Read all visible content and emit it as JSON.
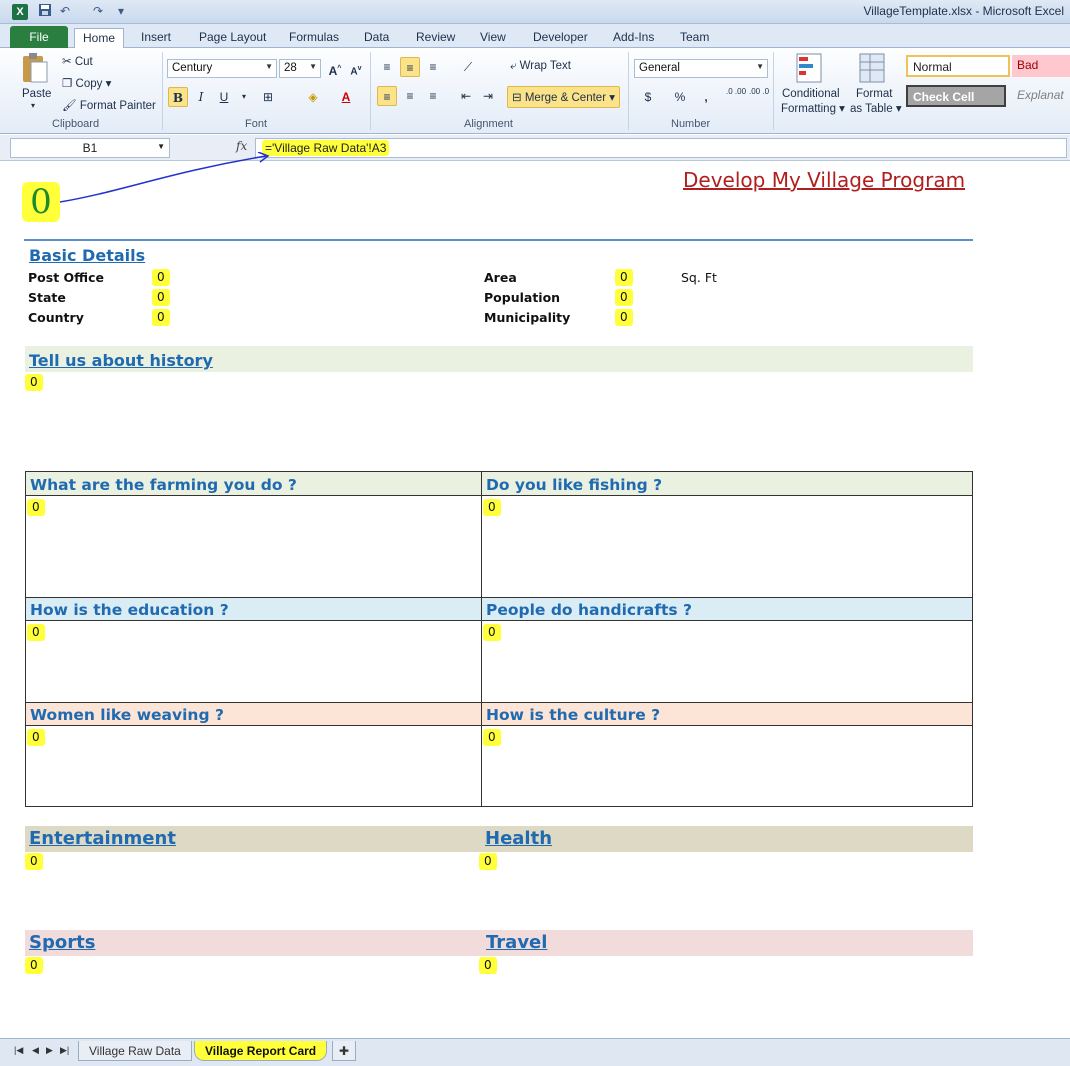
{
  "window": {
    "title": "VillageTemplate.xlsx - Microsoft Excel",
    "app_icon": "X",
    "quick_access": [
      "save-icon",
      "undo-icon",
      "redo-icon"
    ]
  },
  "ribbon_tabs": [
    "File",
    "Home",
    "Insert",
    "Page Layout",
    "Formulas",
    "Data",
    "Review",
    "View",
    "Developer",
    "Add-Ins",
    "Team"
  ],
  "active_tab": "Home",
  "clipboard": {
    "paste": "Paste",
    "cut": "Cut",
    "copy": "Copy",
    "format_painter": "Format Painter",
    "group": "Clipboard"
  },
  "font": {
    "name": "Century",
    "size": "28",
    "group": "Font",
    "bold": "B",
    "italic": "I",
    "underline": "U"
  },
  "alignment": {
    "wrap_text": "Wrap Text",
    "merge_center": "Merge & Center",
    "group": "Alignment"
  },
  "number": {
    "format": "General",
    "currency": "$",
    "percent": "%",
    "comma": ",",
    "inc_decimal": ".0 .00",
    "dec_decimal": ".00 .0",
    "group": "Number"
  },
  "styles": {
    "conditional": "Conditional",
    "conditional2": "Formatting",
    "format": "Format",
    "format2": "as Table",
    "normal": "Normal",
    "bad": "Bad",
    "check_cell": "Check Cell",
    "explanatory": "Explanat"
  },
  "formula_bar": {
    "name_box": "B1",
    "fx": "fx",
    "formula": "='Village Raw Data'!A3"
  },
  "sheet": {
    "cell_b1": "0",
    "report_title": "Develop My Village Program",
    "basic_details": {
      "title": "Basic Details",
      "post_office_label": "Post Office",
      "post_office": "0",
      "state_label": "State",
      "state": "0",
      "country_label": "Country",
      "country": "0",
      "area_label": "Area",
      "area": "0",
      "area_unit": "Sq. Ft",
      "population_label": "Population",
      "population": "0",
      "municipality_label": "Municipality",
      "municipality": "0"
    },
    "history": {
      "title": "Tell us about history",
      "value": "0"
    },
    "questions": {
      "farming": {
        "title": "What are the farming you do ?",
        "value": "0"
      },
      "fishing": {
        "title": "Do you like fishing ?",
        "value": "0"
      },
      "education": {
        "title": "How is the education ?",
        "value": "0"
      },
      "handicrafts": {
        "title": "People do handicrafts ?",
        "value": "0"
      },
      "weaving": {
        "title": "Women like weaving ?",
        "value": "0"
      },
      "culture": {
        "title": "How is the culture ?",
        "value": "0"
      }
    },
    "entertainment": {
      "title": "Entertainment",
      "value": "0"
    },
    "health": {
      "title": "Health",
      "value": "0"
    },
    "sports": {
      "title": "Sports",
      "value": "0"
    },
    "travel": {
      "title": "Travel",
      "value": "0"
    }
  },
  "sheet_tabs": [
    "Village Raw Data",
    "Village Report Card"
  ],
  "active_sheet": "Village Report Card",
  "colors": {
    "heading_blue": "#1f6ab0",
    "highlight": "#ffff3a",
    "title_red": "#b01f1f"
  }
}
